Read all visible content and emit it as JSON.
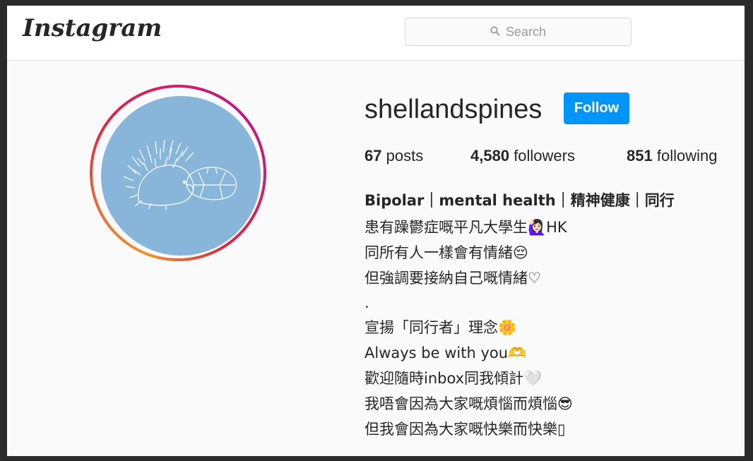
{
  "header": {
    "logo": "Instagram",
    "search_placeholder": "Search"
  },
  "profile": {
    "username": "shellandspines",
    "follow_label": "Follow",
    "stats": {
      "posts_count": "67",
      "posts_label": "posts",
      "followers_count": "4,580",
      "followers_label": "followers",
      "following_count": "851",
      "following_label": "following"
    },
    "bio": {
      "title": "Bipolar｜mental health｜精神健康｜同行",
      "lines": [
        "患有躁鬱症嘅平凡大學生🙋🏻‍♀️HK",
        "同所有人一樣會有情緒😔",
        "但強調要接納自己嘅情緒♡",
        ".",
        "宣揚「同行者」理念🌼",
        "Always be with you🫶",
        "歡迎隨時inbox同我傾計🤍",
        "我唔會因為大家嘅煩惱而煩惱😎",
        "但我會因為大家嘅快樂而快樂▯"
      ]
    }
  },
  "colors": {
    "follow_button": "#0095f6",
    "avatar_bg": "#88b6db",
    "text": "#262626"
  }
}
